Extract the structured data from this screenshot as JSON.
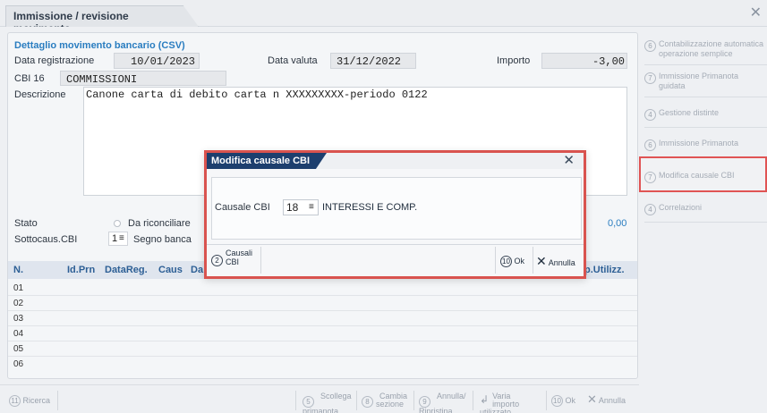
{
  "window": {
    "tab_title": "Immissione / revisione movimento",
    "close_glyph": "✕"
  },
  "form": {
    "section_title": "Dettaglio movimento bancario (CSV)",
    "data_registrazione_label": "Data registrazione",
    "data_registrazione": "10/01/2023",
    "data_valuta_label": "Data valuta",
    "data_valuta": "31/12/2022",
    "importo_label": "Importo",
    "importo": "-3,00",
    "cbi_label": "CBI 16",
    "cbi_value": "COMMISSIONI",
    "descrizione_label": "Descrizione",
    "descrizione": "Canone carta di debito carta n XXXXXXXXX-periodo 0122",
    "stato_label": "Stato",
    "stato_option": "Da riconciliare",
    "sottocaus_label": "Sottocaus.CBI",
    "sottocaus_value": "1",
    "segno_banca_label": "Segno banca",
    "right_amount": "0,00"
  },
  "grid": {
    "headers": [
      "N.",
      "Id.Prn",
      "DataReg.",
      "Caus",
      "Da",
      "p.Utilizz."
    ],
    "rows": [
      "01",
      "02",
      "03",
      "04",
      "05",
      "06"
    ]
  },
  "bottom_toolbar": {
    "ricerca": {
      "num": "11",
      "label": "Ricerca"
    },
    "scollega": {
      "num": "5",
      "label1": "Scollega",
      "label2": "primanota"
    },
    "cambia": {
      "num": "8",
      "label1": "Cambia",
      "label2": "sezione"
    },
    "annulla_ripristina": {
      "num": "9",
      "label1": "Annulla/",
      "label2": "Ripristina"
    },
    "varia": {
      "label1": "Varia importo",
      "label2": "utilizzato"
    },
    "ok": {
      "num": "10",
      "label": "Ok"
    },
    "annulla": {
      "label": "Annulla"
    }
  },
  "side_panel": {
    "items": [
      {
        "num": "6",
        "label": "Contabilizzazione automatica operazione semplice"
      },
      {
        "num": "7",
        "label": "Immissione Primanota guidata"
      },
      {
        "num": "4",
        "label": "Gestione distinte"
      },
      {
        "num": "6",
        "label": "Immissione Primanota"
      },
      {
        "num": "7",
        "label": "Modifica causale CBI"
      },
      {
        "num": "4",
        "label": "Correlazioni"
      }
    ]
  },
  "modal": {
    "title": "Modifica causale CBI",
    "causale_label": "Causale CBI",
    "causale_code": "18",
    "causale_desc": "INTERESSI E COMP.",
    "causali_btn_num": "2",
    "causali_btn_label1": "Causali",
    "causali_btn_label2": "CBI",
    "ok_num": "10",
    "ok_label": "Ok",
    "annulla_label": "Annulla"
  },
  "colors": {
    "accent_blue": "#2a7dc0",
    "header_navy": "#1d3f6e",
    "highlight_red": "#d9534f"
  }
}
